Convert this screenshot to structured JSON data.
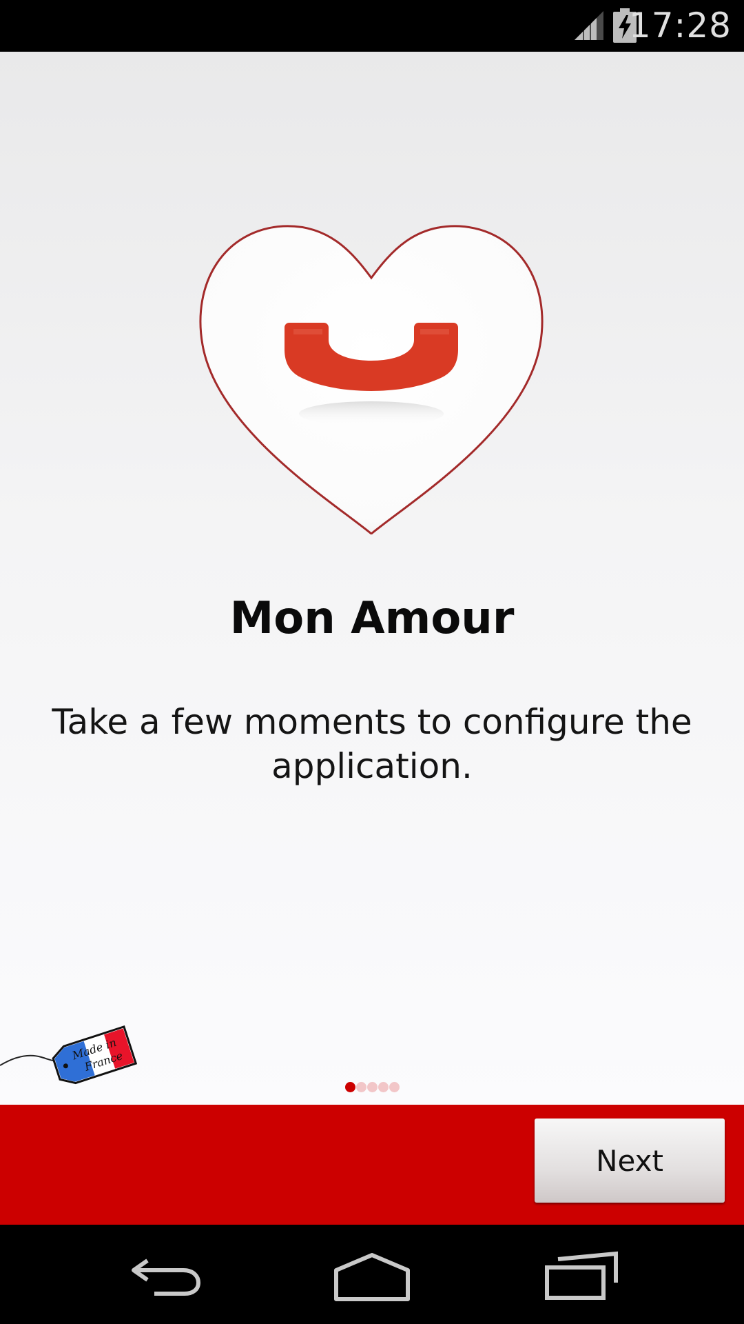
{
  "status_bar": {
    "time": "17:28",
    "signal_icon": "signal-icon",
    "battery_icon": "battery-charging-icon"
  },
  "app": {
    "title": "Mon Amour",
    "description": "Take a few moments to configure the application.",
    "logo_icon": "heart-phone-icon",
    "badge_icon": "made-in-france-tag-icon",
    "badge_text_line1": "Made in",
    "badge_text_line2": "France"
  },
  "pager": {
    "total": 5,
    "current": 1
  },
  "actions": {
    "next_label": "Next"
  },
  "navigation": {
    "back_icon": "back-icon",
    "home_icon": "home-icon",
    "recents_icon": "recents-icon"
  },
  "colors": {
    "accent": "#cc0000",
    "pager_inactive": "#f2c6c8",
    "phone_red": "#d93a24"
  }
}
